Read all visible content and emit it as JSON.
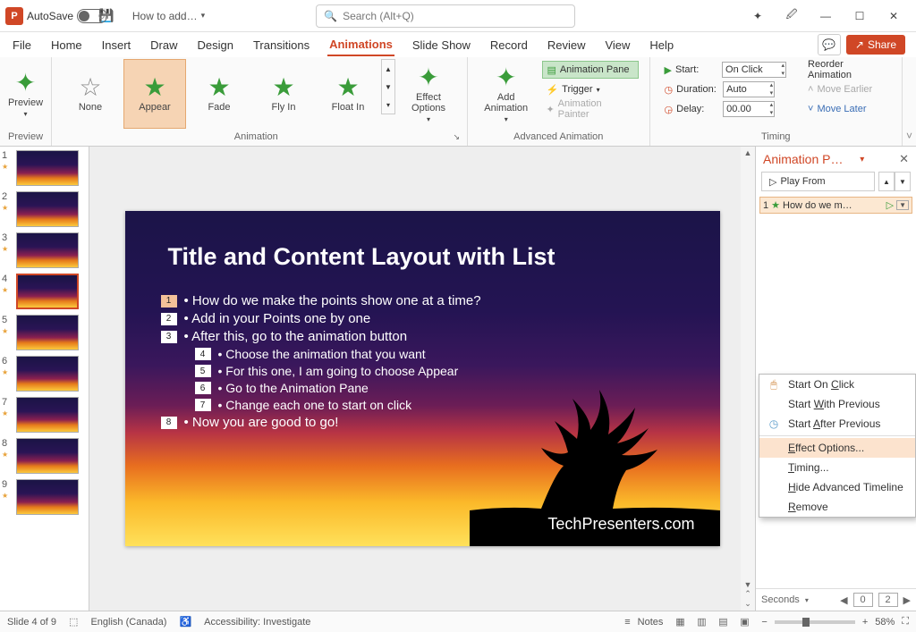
{
  "titlebar": {
    "app_letter": "P",
    "autosave_label": "AutoSave",
    "autosave_state": "Off",
    "doc_title": "How to add…",
    "search_placeholder": "Search (Alt+Q)"
  },
  "menu": {
    "tabs": [
      "File",
      "Home",
      "Insert",
      "Draw",
      "Design",
      "Transitions",
      "Animations",
      "Slide Show",
      "Record",
      "Review",
      "View",
      "Help"
    ],
    "active_index": 6,
    "share_label": "Share"
  },
  "ribbon": {
    "preview": {
      "label": "Preview",
      "group": "Preview"
    },
    "gallery": [
      {
        "name": "None",
        "color": "gray"
      },
      {
        "name": "Appear",
        "color": "green",
        "selected": true
      },
      {
        "name": "Fade",
        "color": "green"
      },
      {
        "name": "Fly In",
        "color": "green"
      },
      {
        "name": "Float In",
        "color": "green"
      }
    ],
    "animation_group": "Animation",
    "effect_options": "Effect\nOptions",
    "add_animation": "Add\nAnimation",
    "animation_pane": "Animation Pane",
    "trigger": "Trigger",
    "animation_painter": "Animation Painter",
    "advanced_group": "Advanced Animation",
    "start_label": "Start:",
    "start_value": "On Click",
    "duration_label": "Duration:",
    "duration_value": "Auto",
    "delay_label": "Delay:",
    "delay_value": "00.00",
    "reorder": "Reorder Animation",
    "move_earlier": "Move Earlier",
    "move_later": "Move Later",
    "timing_group": "Timing"
  },
  "thumbnails": {
    "count": 9,
    "selected": 4
  },
  "slide": {
    "title": "Title and Content Layout with List",
    "bullets": [
      {
        "tag": "1",
        "hl": true,
        "text": "How do we make the points show one at a time?"
      },
      {
        "tag": "2",
        "text": "Add in your Points one by one"
      },
      {
        "tag": "3",
        "text": "After this, go to the animation button"
      },
      {
        "tag": "4",
        "sub": true,
        "text": "Choose the animation that you want"
      },
      {
        "tag": "5",
        "sub": true,
        "text": "For this one, I am going to choose Appear"
      },
      {
        "tag": "6",
        "sub": true,
        "text": "Go to the Animation Pane"
      },
      {
        "tag": "7",
        "sub": true,
        "text": "Change each one to start on click"
      },
      {
        "tag": "8",
        "text": "Now you are good to go!"
      }
    ],
    "footer": "TechPresenters.com"
  },
  "anim_pane": {
    "title": "Animation P…",
    "play": "Play From",
    "item_num": "1",
    "item_text": "How do we m…"
  },
  "ctx_menu": {
    "start_click": "Start On Click",
    "start_with": "Start With Previous",
    "start_after": "Start After Previous",
    "effect_options": "Effect Options...",
    "timing": "Timing...",
    "hide": "Hide Advanced Timeline",
    "remove": "Remove"
  },
  "seconds": {
    "label": "Seconds",
    "val1": "0",
    "val2": "2"
  },
  "statusbar": {
    "slide": "Slide 4 of 9",
    "lang": "English (Canada)",
    "access": "Accessibility: Investigate",
    "notes": "Notes",
    "zoom": "58%"
  }
}
